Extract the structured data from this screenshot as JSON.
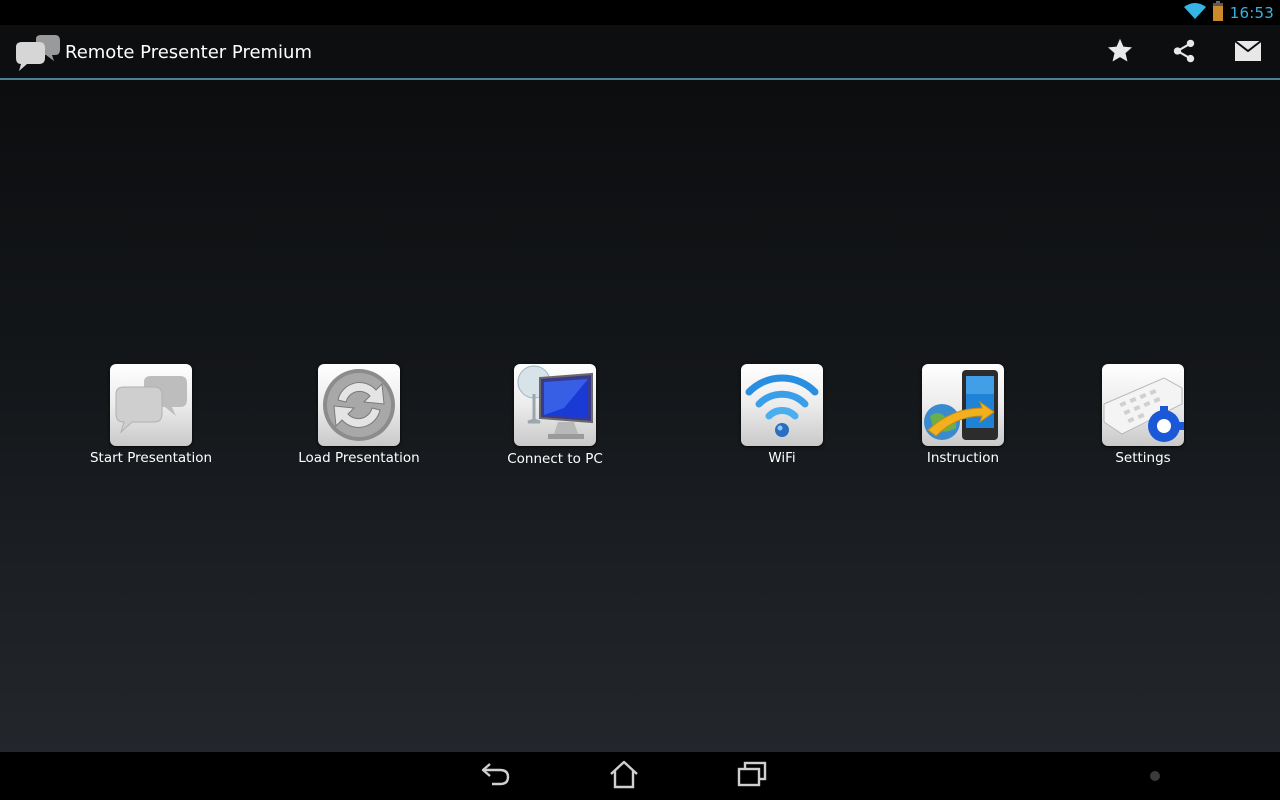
{
  "status_bar": {
    "time": "16:53",
    "icons": [
      "wifi-icon",
      "battery-icon"
    ]
  },
  "action_bar": {
    "title": "Remote Presenter Premium",
    "logo_icon": "chat-bubbles-icon",
    "actions": [
      {
        "name": "favorite",
        "icon": "star-icon"
      },
      {
        "name": "share",
        "icon": "share-icon"
      },
      {
        "name": "email",
        "icon": "envelope-icon"
      }
    ]
  },
  "menu": {
    "items": [
      {
        "label": "Start Presentation",
        "icon": "chat-bubbles-icon"
      },
      {
        "label": "Load Presentation",
        "icon": "refresh-icon"
      },
      {
        "label": "Connect to PC",
        "icon": "monitor-icon"
      },
      {
        "label": "WiFi",
        "icon": "wifi-icon"
      },
      {
        "label": "Instruction",
        "icon": "phone-globe-icon"
      },
      {
        "label": "Settings",
        "icon": "keyboard-gear-icon"
      }
    ]
  },
  "nav_bar": {
    "buttons": [
      "back-icon",
      "home-icon",
      "recents-icon"
    ]
  },
  "colors": {
    "accent": "#34b5e5",
    "action_bar_divider": "#4d7f97",
    "background_top": "#0c0d0f",
    "background_bottom": "#23272c"
  }
}
